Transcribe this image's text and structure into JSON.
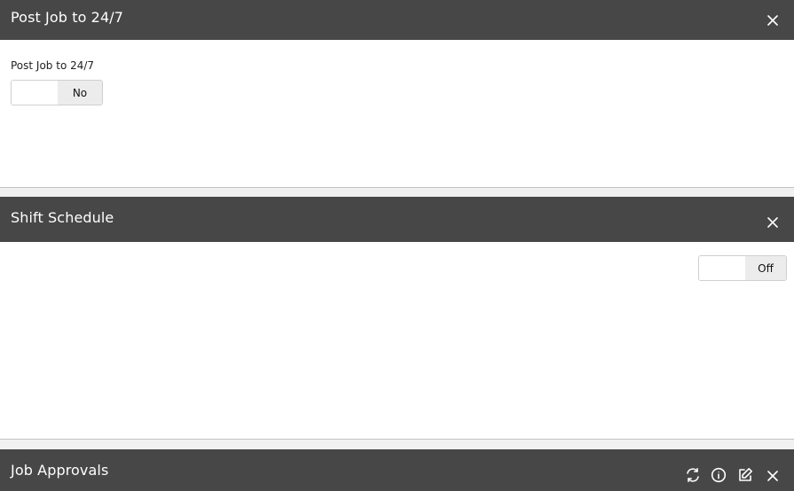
{
  "post_job_panel": {
    "title": "Post Job to 24/7",
    "field_label": "Post Job to 24/7",
    "toggle_state": "No",
    "close_icon": "close-icon"
  },
  "shift_schedule_panel": {
    "title": "Shift Schedule",
    "toggle_state": "Off",
    "close_icon": "close-icon"
  },
  "job_approvals_panel": {
    "title": "Job Approvals",
    "icons": [
      "refresh-icon",
      "info-icon",
      "edit-icon",
      "close-icon"
    ]
  },
  "colors": {
    "header_bg": "#474747",
    "header_text": "#ffffff",
    "toggle_state_bg": "#ececec",
    "separator": "#c4c4c4"
  }
}
